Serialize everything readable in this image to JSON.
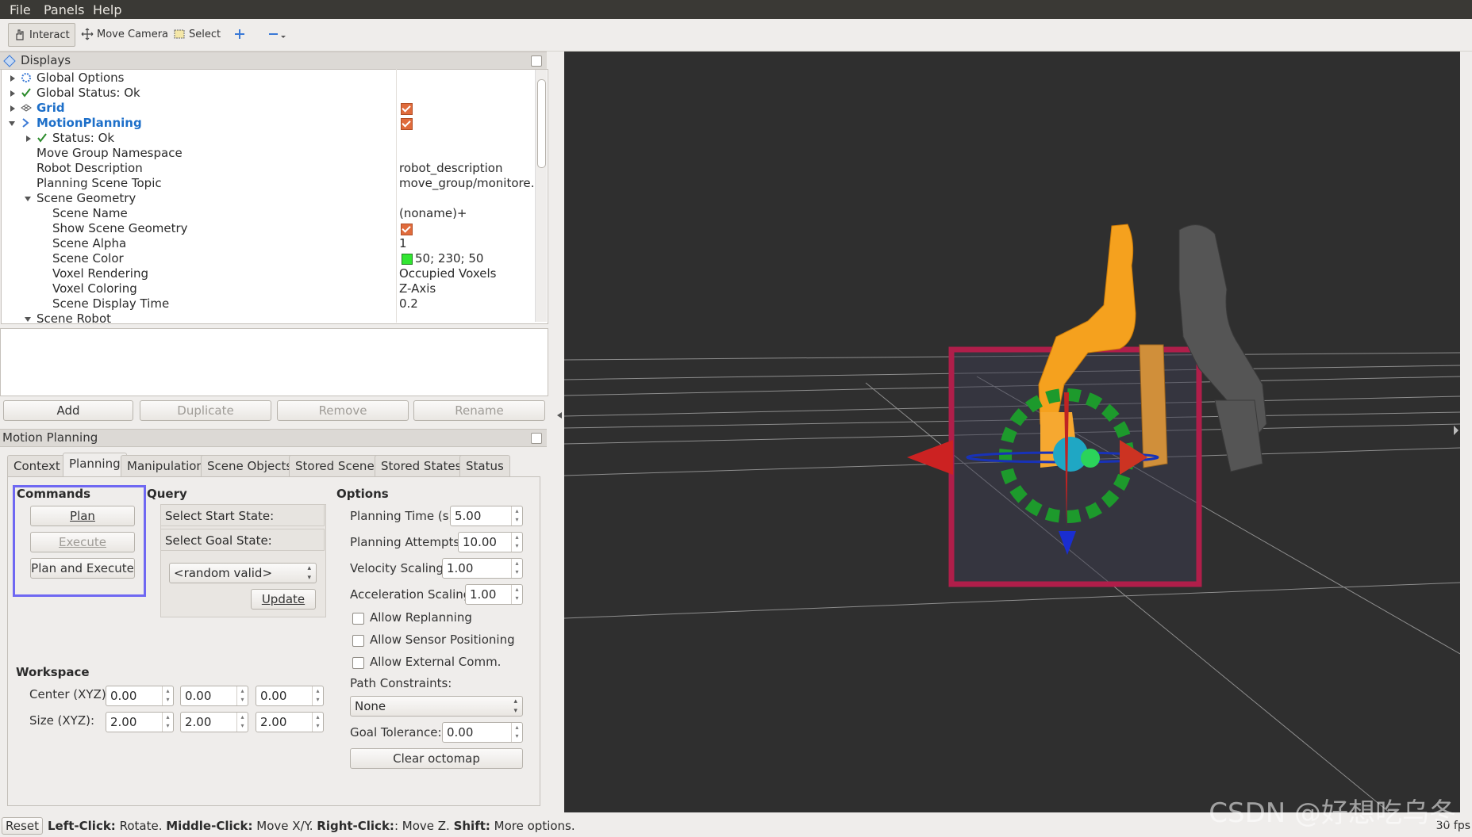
{
  "menu": {
    "file": "File",
    "panels": "Panels",
    "help": "Help"
  },
  "toolbar": {
    "interact": "Interact",
    "move_camera": "Move Camera",
    "select": "Select",
    "icons": [
      "hand-icon",
      "move-camera-icon",
      "select-box-icon",
      "crosshair-plus-icon",
      "minus-icon",
      "dropdown-arrow-icon"
    ]
  },
  "displays": {
    "title": "Displays",
    "rows": [
      {
        "label": "Global Options",
        "value": ""
      },
      {
        "label": "Global Status: Ok",
        "value": ""
      },
      {
        "label": "Grid",
        "value": "checked"
      },
      {
        "label": "MotionPlanning",
        "value": "checked"
      },
      {
        "label": "Status: Ok",
        "value": ""
      },
      {
        "label": "Move Group Namespace",
        "value": ""
      },
      {
        "label": "Robot Description",
        "value": "robot_description"
      },
      {
        "label": "Planning Scene Topic",
        "value": "move_group/monitore…"
      },
      {
        "label": "Scene Geometry",
        "value": ""
      },
      {
        "label": "Scene Name",
        "value": "(noname)+"
      },
      {
        "label": "Show Scene Geometry",
        "value": "checked"
      },
      {
        "label": "Scene Alpha",
        "value": "1"
      },
      {
        "label": "Scene Color",
        "value": "50; 230; 50"
      },
      {
        "label": "Voxel Rendering",
        "value": "Occupied Voxels"
      },
      {
        "label": "Voxel Coloring",
        "value": "Z-Axis"
      },
      {
        "label": "Scene Display Time",
        "value": "0.2"
      },
      {
        "label": "Scene Robot",
        "value": ""
      }
    ]
  },
  "display_buttons": {
    "add": "Add",
    "duplicate": "Duplicate",
    "remove": "Remove",
    "rename": "Rename"
  },
  "motion_planning": {
    "title": "Motion Planning",
    "tabs": [
      "Context",
      "Planning",
      "Manipulation",
      "Scene Objects",
      "Stored Scenes",
      "Stored States",
      "Status"
    ],
    "selected_tab": "Planning",
    "commands": {
      "title": "Commands",
      "plan": "Plan",
      "execute": "Execute",
      "plan_and_execute": "Plan and Execute"
    },
    "query": {
      "title": "Query",
      "select_start": "Select Start State:",
      "select_goal": "Select Goal State:",
      "goal_combo": "<random valid>",
      "update": "Update"
    },
    "options": {
      "title": "Options",
      "planning_time_label": "Planning Time (s):",
      "planning_time": "5.00",
      "planning_attempts_label": "Planning Attempts:",
      "planning_attempts": "10.00",
      "velocity_scaling_label": "Velocity Scaling:",
      "velocity_scaling": "1.00",
      "acceleration_scaling_label": "Acceleration Scaling:",
      "acceleration_scaling": "1.00",
      "allow_replanning": "Allow Replanning",
      "allow_sensor_positioning": "Allow Sensor Positioning",
      "allow_external_comm": "Allow External Comm.",
      "path_constraints_label": "Path Constraints:",
      "path_constraints": "None",
      "goal_tolerance_label": "Goal Tolerance:",
      "goal_tolerance": "0.00",
      "clear_octomap": "Clear octomap"
    },
    "workspace": {
      "title": "Workspace",
      "center_label": "Center (XYZ):",
      "center": [
        "0.00",
        "0.00",
        "0.00"
      ],
      "size_label": "Size (XYZ):",
      "size": [
        "2.00",
        "2.00",
        "2.00"
      ]
    }
  },
  "statusbar": {
    "reset": "Reset",
    "left_click_key": "Left-Click:",
    "left_click_val": " Rotate.",
    "middle_click_key": "Middle-Click:",
    "middle_click_val": " Move X/Y.",
    "right_click_key": "Right-Click:",
    "right_click_val": ": Move Z.",
    "shift_key": "Shift:",
    "shift_val": " More options.",
    "fps": "30 fps"
  },
  "watermark": "CSDN @好想吃乌冬",
  "colors": {
    "scene_color": "#32e632",
    "highlight": "#6f68f2",
    "accent_orange": "#f5a11e"
  }
}
